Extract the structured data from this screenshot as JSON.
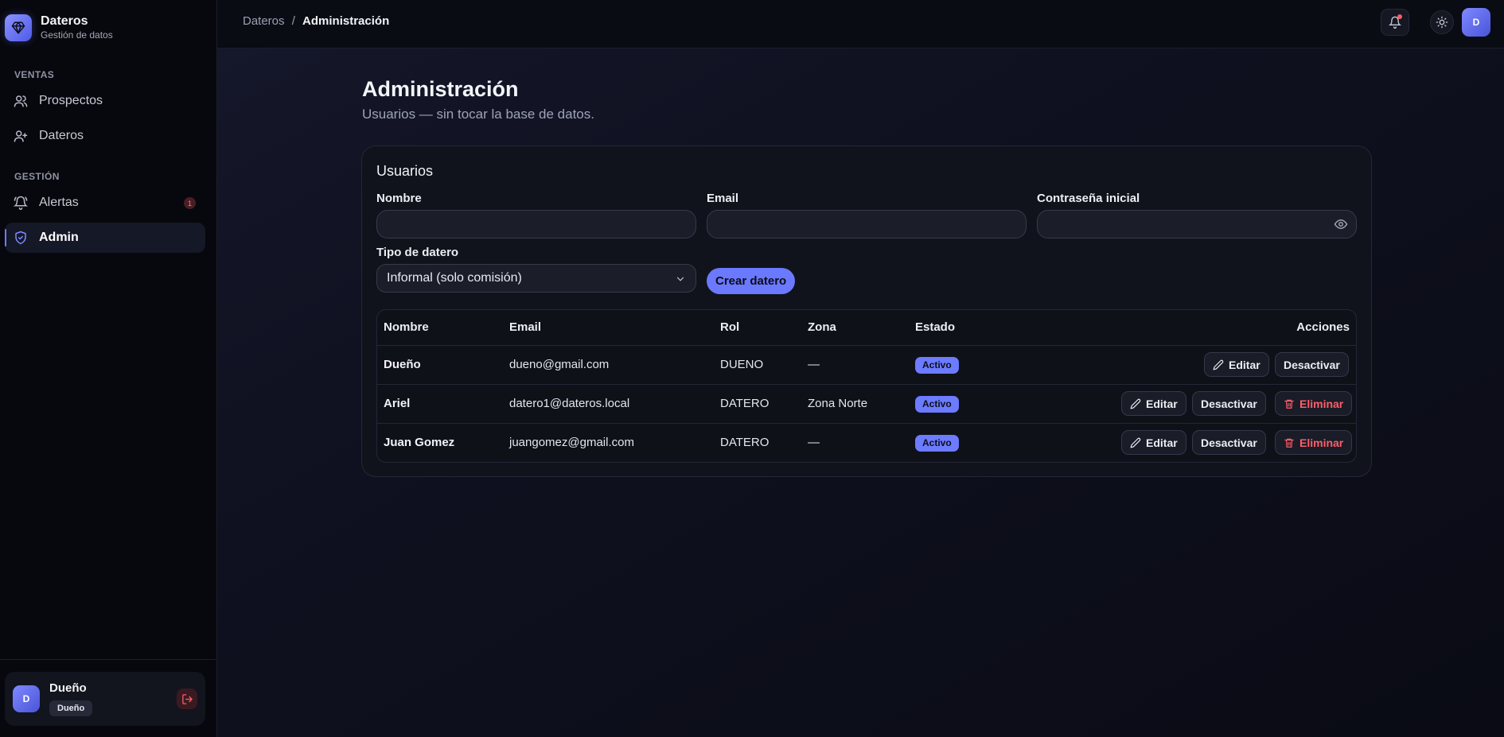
{
  "brand": {
    "title": "Dateros",
    "subtitle": "Gestión de datos"
  },
  "sidebar": {
    "sections": [
      {
        "label": "VENTAS"
      },
      {
        "label": "GESTIÓN"
      }
    ],
    "items": [
      {
        "label": "Prospectos",
        "icon": "users-icon"
      },
      {
        "label": "Dateros",
        "icon": "user-plus-icon"
      },
      {
        "label": "Alertas",
        "icon": "bell-icon",
        "badge": "1"
      },
      {
        "label": "Admin",
        "icon": "shield-icon",
        "active": true
      }
    ],
    "user": {
      "avatar": "D",
      "name": "Dueño",
      "role": "Dueño"
    }
  },
  "header": {
    "breadcrumb": {
      "parent": "Dateros",
      "separator": "/",
      "current": "Administración"
    },
    "avatar": "D"
  },
  "page": {
    "title": "Administración",
    "subtitle": "Usuarios — sin tocar la base de datos."
  },
  "form": {
    "card_title": "Usuarios",
    "name_label": "Nombre",
    "name_value": "",
    "email_label": "Email",
    "email_value": "",
    "password_label": "Contraseña inicial",
    "password_value": "",
    "type_label": "Tipo de datero",
    "type_selected": "Informal (solo comisión)",
    "submit_label": "Crear datero"
  },
  "table": {
    "headers": [
      "Nombre",
      "Email",
      "Rol",
      "Zona",
      "Estado",
      "Acciones"
    ],
    "rows": [
      {
        "name": "Dueño",
        "email": "dueno@gmail.com",
        "role": "DUENO",
        "zone": "—",
        "status": "Activo",
        "edit": "Editar",
        "deactivate": "Desactivar"
      },
      {
        "name": "Ariel",
        "email": "datero1@dateros.local",
        "role": "DATERO",
        "zone": "Zona Norte",
        "status": "Activo",
        "edit": "Editar",
        "deactivate": "Desactivar",
        "delete": "Eliminar"
      },
      {
        "name": "Juan Gomez",
        "email": "juangomez@gmail.com",
        "role": "DATERO",
        "zone": "—",
        "status": "Activo",
        "edit": "Editar",
        "deactivate": "Desactivar",
        "delete": "Eliminar"
      }
    ]
  },
  "colors": {
    "accent": "#6b79ff",
    "danger": "#ff5e6a",
    "background": "#0b0d17"
  }
}
